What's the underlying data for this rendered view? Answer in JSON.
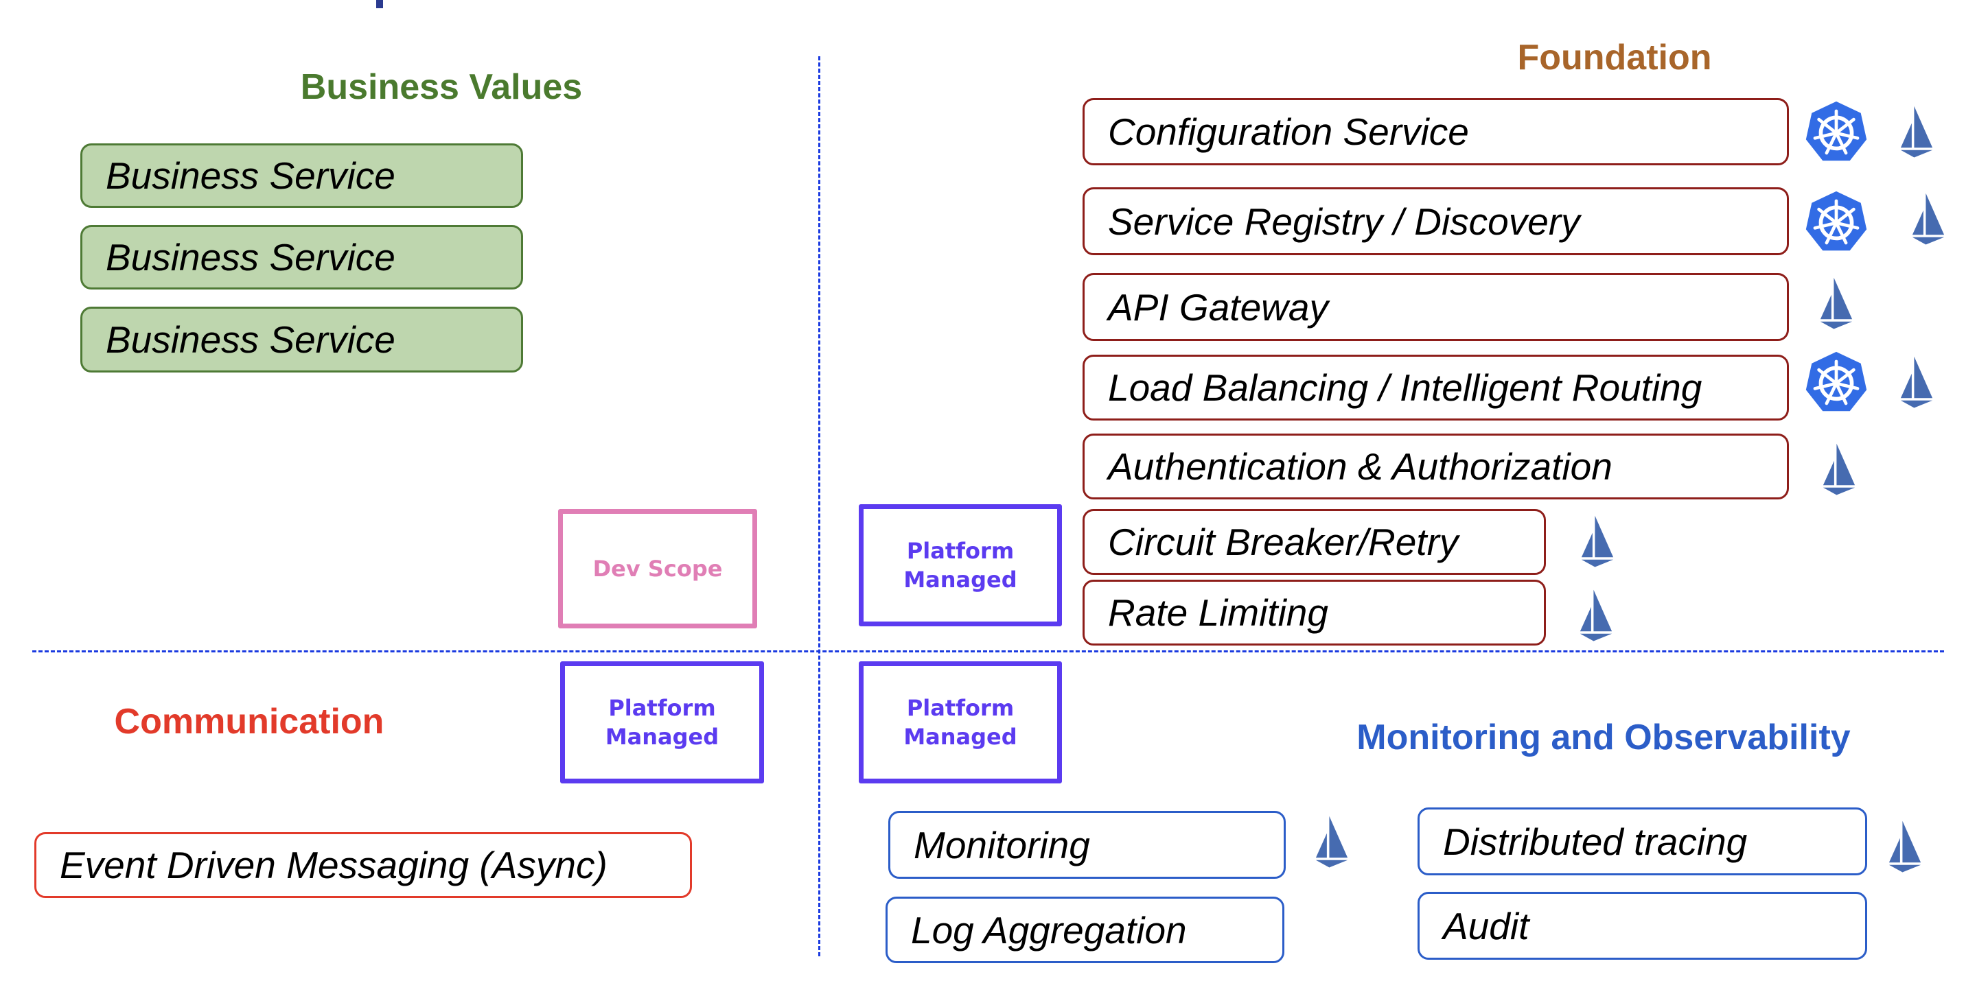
{
  "colors": {
    "business": "#4A7A2E",
    "foundation": "#A8652A",
    "communication": "#E23A2A",
    "monitoring": "#2B5DC8",
    "dev_scope": "#E07EB5",
    "platform_managed": "#5B3BF0",
    "kubernetes": "#326CE5",
    "istio": "#466BB0",
    "divider": "#1A3AE0"
  },
  "quadrants": {
    "business_values": {
      "heading": "Business Values",
      "items": [
        "Business Service",
        "Business Service",
        "Business Service"
      ]
    },
    "foundation": {
      "heading": "Foundation",
      "items": [
        {
          "label": "Configuration Service",
          "icons": [
            "kubernetes-icon",
            "istio-icon"
          ]
        },
        {
          "label": "Service Registry / Discovery",
          "icons": [
            "kubernetes-icon",
            "istio-icon"
          ]
        },
        {
          "label": "API Gateway",
          "icons": [
            "istio-icon"
          ]
        },
        {
          "label": "Load Balancing / Intelligent Routing",
          "icons": [
            "kubernetes-icon",
            "istio-icon"
          ]
        },
        {
          "label": "Authentication & Authorization",
          "icons": [
            "istio-icon"
          ]
        },
        {
          "label": "Circuit Breaker/Retry",
          "icons": [
            "istio-icon"
          ]
        },
        {
          "label": "Rate Limiting",
          "icons": [
            "istio-icon"
          ]
        }
      ]
    },
    "communication": {
      "heading": "Communication",
      "items": [
        "Event Driven Messaging (Async)"
      ]
    },
    "monitoring": {
      "heading": "Monitoring and Observability",
      "items": [
        {
          "label": "Monitoring",
          "icons": [
            "istio-icon"
          ]
        },
        {
          "label": "Log Aggregation",
          "icons": []
        },
        {
          "label": "Distributed tracing",
          "icons": [
            "istio-icon"
          ]
        },
        {
          "label": "Audit",
          "icons": []
        }
      ]
    }
  },
  "scope_tags": {
    "dev_scope": "Dev Scope",
    "platform_managed_line1": "Platform",
    "platform_managed_line2": "Managed"
  }
}
